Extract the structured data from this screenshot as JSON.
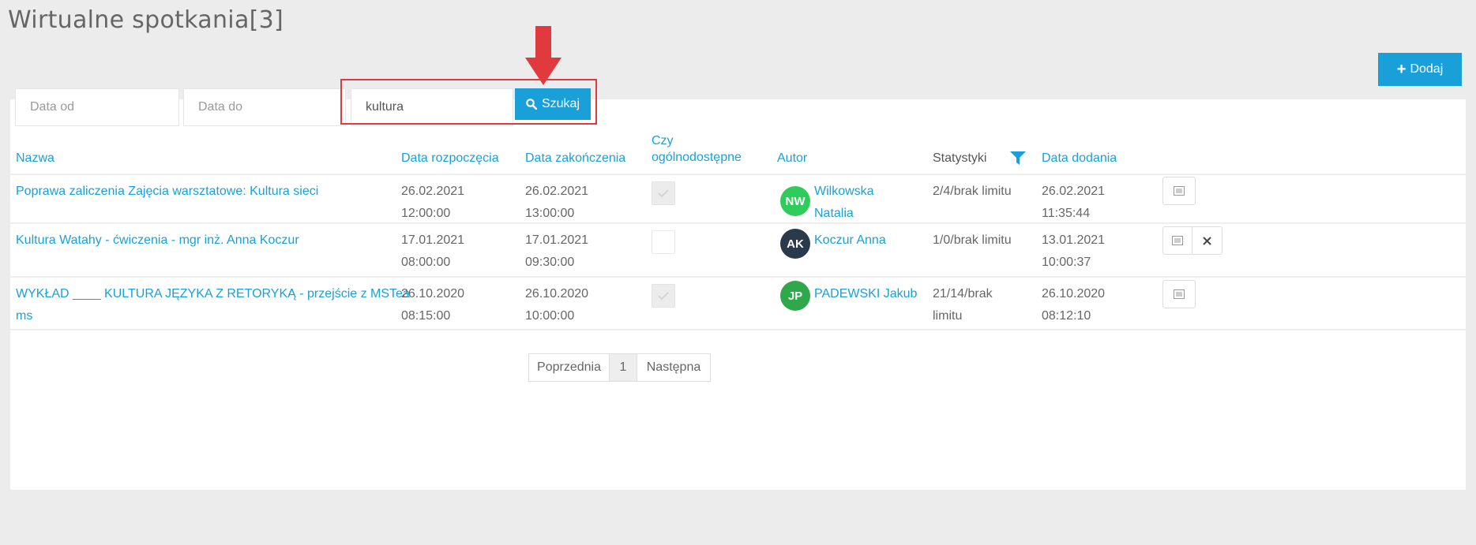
{
  "page": {
    "title": "Wirtualne spotkania[3]"
  },
  "toolbar": {
    "add_plus": "+",
    "add_label": "Dodaj"
  },
  "filters": {
    "date_from_placeholder": "Data od",
    "date_to_placeholder": "Data do",
    "search_value": "kultura",
    "search_label": "Szukaj"
  },
  "table": {
    "headers": {
      "name": "Nazwa",
      "start": "Data rozpoczęcia",
      "end": "Data zakończenia",
      "public_line1": "Czy",
      "public_line2": "ogólnodostępne",
      "author": "Autor",
      "stats": "Statystyki",
      "added": "Data dodania"
    },
    "rows": [
      {
        "name": "Poprawa zaliczenia Zajęcia warsztatowe: Kultura sieci",
        "start_date": "26.02.2021",
        "start_time": "12:00:00",
        "end_date": "26.02.2021",
        "end_time": "13:00:00",
        "public": true,
        "author_initials": "NW",
        "author_line1": "Wilkowska",
        "author_line2": "Natalia",
        "avatar_color": "#2ecc5a",
        "stats_line1": "2/4/brak limitu",
        "stats_line2": "",
        "added_date": "26.02.2021",
        "added_time": "11:35:44"
      },
      {
        "name": "Kultura Watahy - ćwiczenia - mgr inż. Anna Koczur",
        "start_date": "17.01.2021",
        "start_time": "08:00:00",
        "end_date": "17.01.2021",
        "end_time": "09:30:00",
        "public": false,
        "author_initials": "AK",
        "author_line1": "Koczur Anna",
        "author_line2": "",
        "avatar_color": "#2b3a4a",
        "stats_line1": "1/0/brak limitu",
        "stats_line2": "",
        "added_date": "13.01.2021",
        "added_time": "10:00:37"
      },
      {
        "name_line1": "WYKŁAD ____ KULTURA JĘZYKA Z RETORYKĄ - przejście z MSTea",
        "name_line2": "ms",
        "start_date": "26.10.2020",
        "start_time": "08:15:00",
        "end_date": "26.10.2020",
        "end_time": "10:00:00",
        "public": true,
        "author_initials": "JP",
        "author_line1": "PADEWSKI Jakub",
        "author_line2": "",
        "avatar_color": "#2ea84a",
        "stats_line1": "21/14/brak",
        "stats_line2": "limitu",
        "added_date": "26.10.2020",
        "added_time": "08:12:10"
      }
    ]
  },
  "pagination": {
    "prev": "Poprzednia",
    "current": "1",
    "next": "Następna"
  },
  "colors": {
    "accent": "#1aa0d8",
    "highlight": "#e03a3e"
  },
  "icons": {
    "search": "search-icon",
    "filter": "filter-funnel-icon",
    "details": "details-icon",
    "delete": "close-icon",
    "check": "check-icon",
    "arrow": "arrow-down-icon"
  }
}
